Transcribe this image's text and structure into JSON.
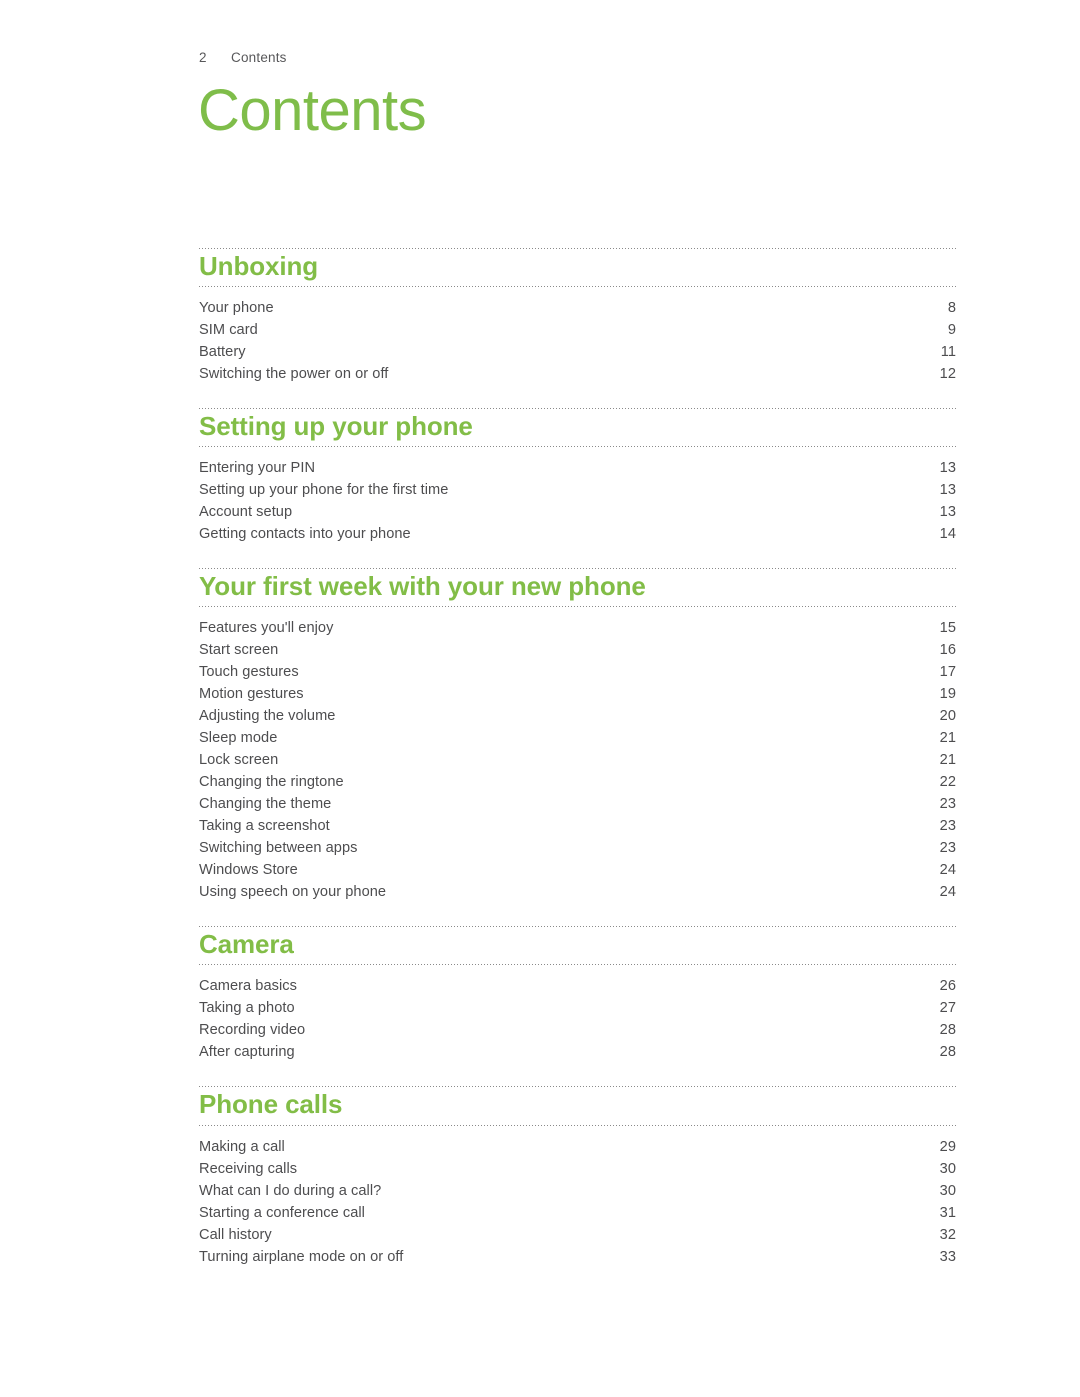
{
  "document": {
    "running_header": {
      "folio": "2",
      "chapter": "Contents"
    },
    "title": "Contents"
  },
  "colors": {
    "accent_green": "#82bd47",
    "title_green": "#7fbd4a",
    "body_text": "#4d4d4f",
    "rule": "#8a8a8a",
    "page_background": "#ffffff"
  },
  "toc": {
    "sections": [
      {
        "heading": "Unboxing",
        "entries": [
          {
            "title": "Your phone",
            "page": "8"
          },
          {
            "title": "SIM card",
            "page": "9"
          },
          {
            "title": "Battery",
            "page": "11"
          },
          {
            "title": "Switching the power on or off",
            "page": "12"
          }
        ]
      },
      {
        "heading": "Setting up your phone",
        "entries": [
          {
            "title": "Entering your PIN",
            "page": "13"
          },
          {
            "title": "Setting up your phone for the first time",
            "page": "13"
          },
          {
            "title": "Account setup",
            "page": "13"
          },
          {
            "title": "Getting contacts into your phone",
            "page": "14"
          }
        ]
      },
      {
        "heading": "Your first week with your new phone",
        "entries": [
          {
            "title": "Features you'll enjoy",
            "page": "15"
          },
          {
            "title": "Start screen",
            "page": "16"
          },
          {
            "title": "Touch gestures",
            "page": "17"
          },
          {
            "title": "Motion gestures",
            "page": "19"
          },
          {
            "title": "Adjusting the volume",
            "page": "20"
          },
          {
            "title": "Sleep mode",
            "page": "21"
          },
          {
            "title": "Lock screen",
            "page": "21"
          },
          {
            "title": "Changing the ringtone",
            "page": "22"
          },
          {
            "title": "Changing the theme",
            "page": "23"
          },
          {
            "title": "Taking a screenshot",
            "page": "23"
          },
          {
            "title": "Switching between apps",
            "page": "23"
          },
          {
            "title": "Windows Store",
            "page": "24"
          },
          {
            "title": "Using speech on your phone",
            "page": "24"
          }
        ]
      },
      {
        "heading": "Camera",
        "entries": [
          {
            "title": "Camera basics",
            "page": "26"
          },
          {
            "title": "Taking a photo",
            "page": "27"
          },
          {
            "title": "Recording video",
            "page": "28"
          },
          {
            "title": "After capturing",
            "page": "28"
          }
        ]
      },
      {
        "heading": "Phone calls",
        "entries": [
          {
            "title": "Making a call",
            "page": "29"
          },
          {
            "title": "Receiving calls",
            "page": "30"
          },
          {
            "title": "What can I do during a call?",
            "page": "30"
          },
          {
            "title": "Starting a conference call",
            "page": "31"
          },
          {
            "title": "Call history",
            "page": "32"
          },
          {
            "title": "Turning airplane mode on or off",
            "page": "33"
          }
        ]
      }
    ]
  }
}
